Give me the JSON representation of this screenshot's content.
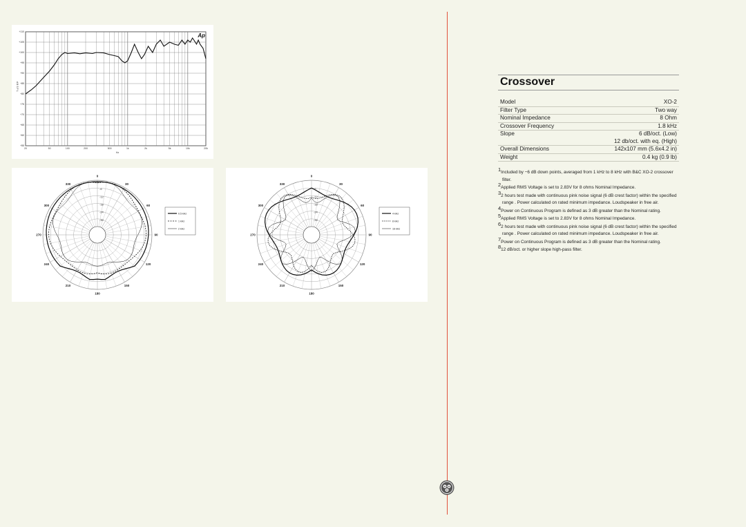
{
  "frequency_chart": {
    "brand_logo": "Ap",
    "y_unit": "d B S P L",
    "x_unit": "Hz",
    "y_ticks": [
      "+110",
      "+105",
      "+100",
      "+95",
      "+90",
      "+85",
      "+80",
      "+75",
      "+70",
      "+65",
      "+60",
      "+55"
    ],
    "x_ticks": [
      "20",
      "50",
      "100",
      "200",
      "500",
      "1k",
      "2k",
      "5k",
      "10k",
      "20k"
    ]
  },
  "polar_chart_1": {
    "angle_labels": [
      "0",
      "30",
      "60",
      "90",
      "120",
      "150",
      "180",
      "210",
      "240",
      "270",
      "300",
      "330"
    ],
    "radial_labels": [
      "-6",
      "-12",
      "-18",
      "-24",
      "-30"
    ],
    "legend": [
      "0.5 kHz",
      "1 kHz",
      "2 kHz"
    ]
  },
  "polar_chart_2": {
    "angle_labels": [
      "0",
      "30",
      "60",
      "90",
      "120",
      "150",
      "180",
      "210",
      "240",
      "270",
      "300",
      "330"
    ],
    "radial_labels": [
      "-6",
      "-12",
      "-18",
      "-24",
      "-30"
    ],
    "legend": [
      "4 kHz",
      "8 kHz",
      "16 kHz"
    ]
  },
  "crossover": {
    "title": "Crossover",
    "specs": [
      {
        "label": "Model",
        "value": "XO-2"
      },
      {
        "label": "Filter Type",
        "value": "Two way"
      },
      {
        "label": "Nominal Impedance",
        "value": "8 Ohm"
      },
      {
        "label": "Crossover Frequency",
        "value": "1.8 kHz"
      },
      {
        "label": "Slope",
        "value": "6 dB/oct. (Low)"
      },
      {
        "label": "",
        "value": "12 db/oct. with eq. (High)"
      },
      {
        "label": "Overall Dimensions",
        "value": "142x107 mm (5.6x4.2 in)"
      },
      {
        "label": "Weight",
        "value": "0.4 kg (0.9 lb)"
      }
    ],
    "notes": [
      {
        "num": "1",
        "text": "Included by −6 dB down points, averaged from 1 kHz to 8 kHz with B&C XO-2 crossover filter."
      },
      {
        "num": "2",
        "text": "Applied RMS Voltage is set to 2.83V for 8 ohms Nominal Impedance."
      },
      {
        "num": "3",
        "text": "2 hours test made with continuous pink noise signal (6 dB crest factor) within the specified range . Power calculated on  rated minimum impedance. Loudspeaker in free air."
      },
      {
        "num": "4",
        "text": "Power on Continuous Program is defined as 3 dB greater than the Nominal rating."
      },
      {
        "num": "5",
        "text": "Applied RMS Voltage is set to 2.83V for 8 ohms Nominal Impedance."
      },
      {
        "num": "6",
        "text": "2 hours test made with continuous pink noise signal (6 dB crest factor) within the specified range . Power calculated on  rated minimum impedance. Loudspeaker in free air."
      },
      {
        "num": "7",
        "text": "Power on Continuous Program is defined as 3 dB greater than the Nominal rating."
      },
      {
        "num": "8",
        "text": "12 dB/oct. or higher slope high-pass filter."
      }
    ]
  },
  "colors": {
    "accent_line": "#e0503a",
    "background": "#f4f5ea"
  }
}
